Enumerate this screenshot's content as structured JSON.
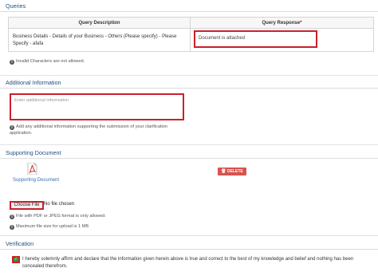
{
  "queries": {
    "title": "Queries",
    "col_description": "Query Description",
    "col_response": "Query Response",
    "required_mark": "*",
    "row_description": "Business Details - Details of your Business - Others (Please specify) - Please Specify - afafa",
    "row_response": "Document is attached",
    "note": "Invalid Characters are not allowed."
  },
  "additional_info": {
    "title": "Additional Information",
    "placeholder": "Enter additional information",
    "note": "Add any additional information supporting the submission of your clarification application."
  },
  "supporting_document": {
    "title": "Supporting Document",
    "file_link": "Supporting Document",
    "delete_label": "DELETE",
    "choose_label": "Choose File",
    "no_file": "No file chosen",
    "note_format": "File with PDF or JPEG format is only allowed.",
    "note_size": "Maximum file size for upload is 1 MB"
  },
  "verification": {
    "title": "Verification",
    "checked": true,
    "text": "I hereby solemnly affirm and declare that the information given herein above is true and correct to the best of my knowledge and belief and nothing has been concealed therefrom."
  },
  "icons": {
    "info": "info-icon",
    "pdf": "pdf-file-icon",
    "trash": "trash-icon",
    "check": "check-icon"
  },
  "colors": {
    "section_title": "#1e4f82",
    "highlight_border": "#cc1f2d",
    "delete_button": "#d9534f",
    "link": "#3a6fb0",
    "checkbox": "#2e9b2e"
  }
}
